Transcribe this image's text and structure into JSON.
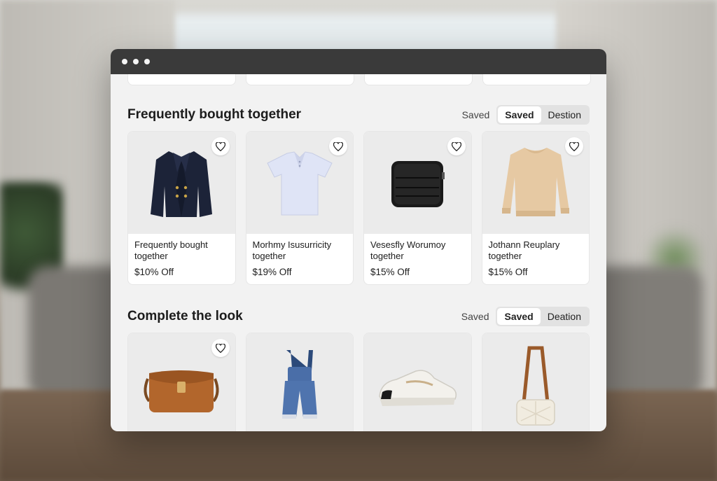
{
  "sections": [
    {
      "title": "Frequently bought together",
      "saved_label": "Saved",
      "segment": [
        "Saved",
        "Destion"
      ],
      "products": [
        {
          "name": "Frequently bought together",
          "price": "$10% Off",
          "icon": "blazer-icon"
        },
        {
          "name": "Morhmy Isusurricity together",
          "price": "$19% Off",
          "icon": "polo-shirt-icon"
        },
        {
          "name": "Vesesfly Worumoy together",
          "price": "$15% Off",
          "icon": "crossbody-bag-icon"
        },
        {
          "name": "Jothann Reuplary together",
          "price": "$15% Off",
          "icon": "sweatshirt-icon"
        }
      ]
    },
    {
      "title": "Complete the look",
      "saved_label": "Saved",
      "segment": [
        "Saved",
        "Deation"
      ],
      "products": [
        {
          "icon": "leather-satchel-icon"
        },
        {
          "icon": "denim-overalls-icon"
        },
        {
          "icon": "sneaker-icon"
        },
        {
          "icon": "quilted-bag-icon"
        }
      ]
    }
  ],
  "colors": {
    "titlebar": "#3a3a3a",
    "window_bg": "#f2f2f2",
    "card_bg": "#ffffff",
    "image_bg": "#ebebeb"
  }
}
